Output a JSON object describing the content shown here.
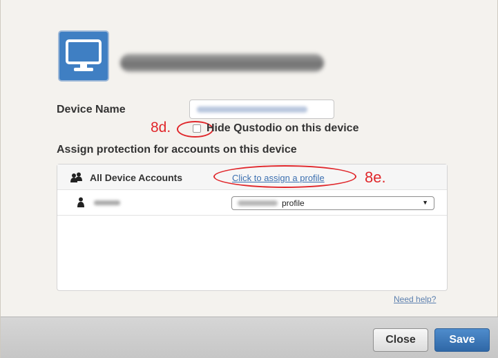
{
  "dialog": {
    "field_label": "Device Name",
    "hide_label": "Hide Qustodio on this device",
    "assign_heading": "Assign protection for accounts on this device",
    "annotation_8d": "8d.",
    "annotation_8e": "8e."
  },
  "accounts_table": {
    "header_label": "All Device Accounts",
    "assign_link": "Click to assign a profile",
    "account_row": {
      "profile_select_value": "profile"
    },
    "help_link": "Need help?"
  },
  "footer": {
    "close_label": "Close",
    "save_label": "Save"
  },
  "colors": {
    "accent": "#3f7fc3",
    "annotation": "#e0262a",
    "save_button": "#2f67a6"
  },
  "icons": [
    "monitor-icon",
    "users-icon",
    "user-icon",
    "caret-down-icon"
  ]
}
